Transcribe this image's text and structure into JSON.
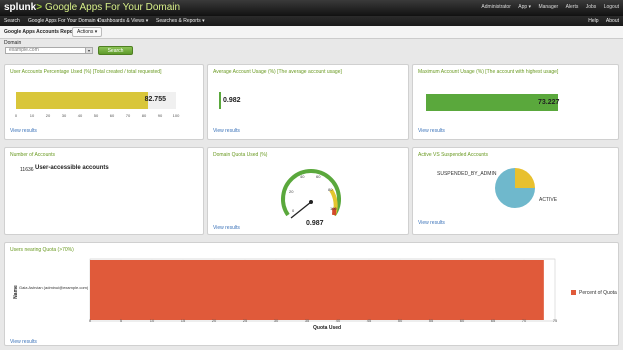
{
  "topbar": {
    "logo": "splunk",
    "logo_arrow": ">",
    "app_name": "Google Apps For Your Domain",
    "user_menu": [
      "Administrator",
      "App ▾",
      "Manager",
      "Alerts",
      "Jobs",
      "Logout"
    ]
  },
  "nav": {
    "items": [
      "Search",
      "Google Apps For Your Domain ▾",
      "Dashboards & Views ▾",
      "Searches & Reports ▾"
    ],
    "right": [
      "Help",
      "About"
    ]
  },
  "subhead": {
    "title": "Google Apps Accounts Report",
    "actions": "Actions ▾"
  },
  "form": {
    "domain_label": "Domain",
    "domain_value": "example.com",
    "search_button": "Search"
  },
  "panels": {
    "p1": {
      "title": "User Accounts Percentage Used (%) [Total created / total requested]",
      "value": "82.755",
      "ticks": [
        "0",
        "10",
        "20",
        "30",
        "40",
        "50",
        "60",
        "70",
        "80",
        "90",
        "100"
      ],
      "link": "View results",
      "fill_color": "#d9c63a",
      "fraction": 0.82755
    },
    "p2": {
      "title": "Average Account Usage (%) [The average account usage]",
      "value": "0.982",
      "link": "View results",
      "fill_color": "#5aa83c",
      "fraction": 0.0098
    },
    "p3": {
      "title": "Maximum Account Usage (%) [The account with highest usage]",
      "value": "73.227",
      "link": "View results",
      "fill_color": "#5aa83c",
      "fraction": 0.73227
    },
    "p4": {
      "title": "Number of Accounts",
      "col_label": "User-accessible accounts",
      "count": "11636"
    },
    "p5": {
      "title": "Domain Quota Used (%)",
      "value": "0.987",
      "ticks": [
        "0",
        "20",
        "40",
        "60",
        "80",
        "100"
      ],
      "link": "View results"
    },
    "p6": {
      "title": "Active VS Suspended Accounts",
      "labels": [
        "SUSPENDED_BY_ADMIN",
        "ACTIVE"
      ],
      "link": "View results"
    },
    "p7": {
      "title": "Users nearing Quota (>70%)",
      "y_title": "Name",
      "x_title": "Quota Used",
      "legend": "Percent of Quota",
      "link": "View results"
    }
  },
  "chart_data": [
    {
      "type": "pie",
      "title": "Active VS Suspended Accounts",
      "slices": [
        {
          "label": "ACTIVE",
          "value": 75,
          "color": "#6fb8cc"
        },
        {
          "label": "SUSPENDED_BY_ADMIN",
          "value": 25,
          "color": "#e8c02e"
        }
      ]
    },
    {
      "type": "bar",
      "title": "Users nearing Quota (>70%)",
      "xlabel": "Quota Used",
      "ylabel": "Name",
      "categories": [
        "Gaia Ashvian (adminui@example.com)"
      ],
      "series": [
        {
          "name": "Percent of Quota",
          "values": [
            73.2
          ]
        }
      ],
      "xlim": [
        0,
        75
      ],
      "color": "#e05a3a",
      "xticks": [
        "0",
        "5",
        "10",
        "15",
        "20",
        "25",
        "30",
        "35",
        "40",
        "45",
        "50",
        "55",
        "60",
        "65",
        "70",
        "75"
      ]
    }
  ]
}
